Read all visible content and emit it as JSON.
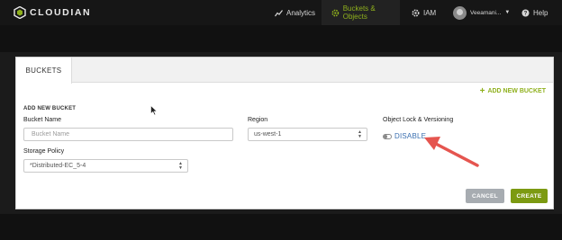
{
  "app": {
    "logo_text": "CLOUDIAN",
    "brand_color": "#8fb01d"
  },
  "nav": {
    "analytics": {
      "label": "Analytics",
      "icon": "analytics-chart-icon"
    },
    "buckets": {
      "label": "Buckets & Objects",
      "icon": "gear-icon",
      "active": true
    },
    "iam": {
      "label": "IAM",
      "icon": "gear-icon"
    },
    "user": {
      "label": "Veeamani...",
      "icon": "avatar-icon"
    },
    "help": {
      "label": "Help",
      "icon": "help-circle-icon"
    }
  },
  "panel": {
    "tab_label": "BUCKETS",
    "add_new_bucket": "ADD NEW BUCKET",
    "section_title": "ADD NEW BUCKET",
    "bucket_name": {
      "label": "Bucket Name",
      "placeholder": "Bucket Name",
      "value": ""
    },
    "region": {
      "label": "Region",
      "selected": "us-west-1"
    },
    "object_lock": {
      "label": "Object Lock & Versioning",
      "toggle_label": "DISABLE",
      "enabled": false
    },
    "storage_policy": {
      "label": "Storage Policy",
      "selected": "*Distributed-EC_5-4"
    },
    "buttons": {
      "cancel": "CANCEL",
      "create": "CREATE"
    }
  },
  "annotation": {
    "arrow_color": "#e5554f",
    "points_to": "object-lock-toggle"
  }
}
